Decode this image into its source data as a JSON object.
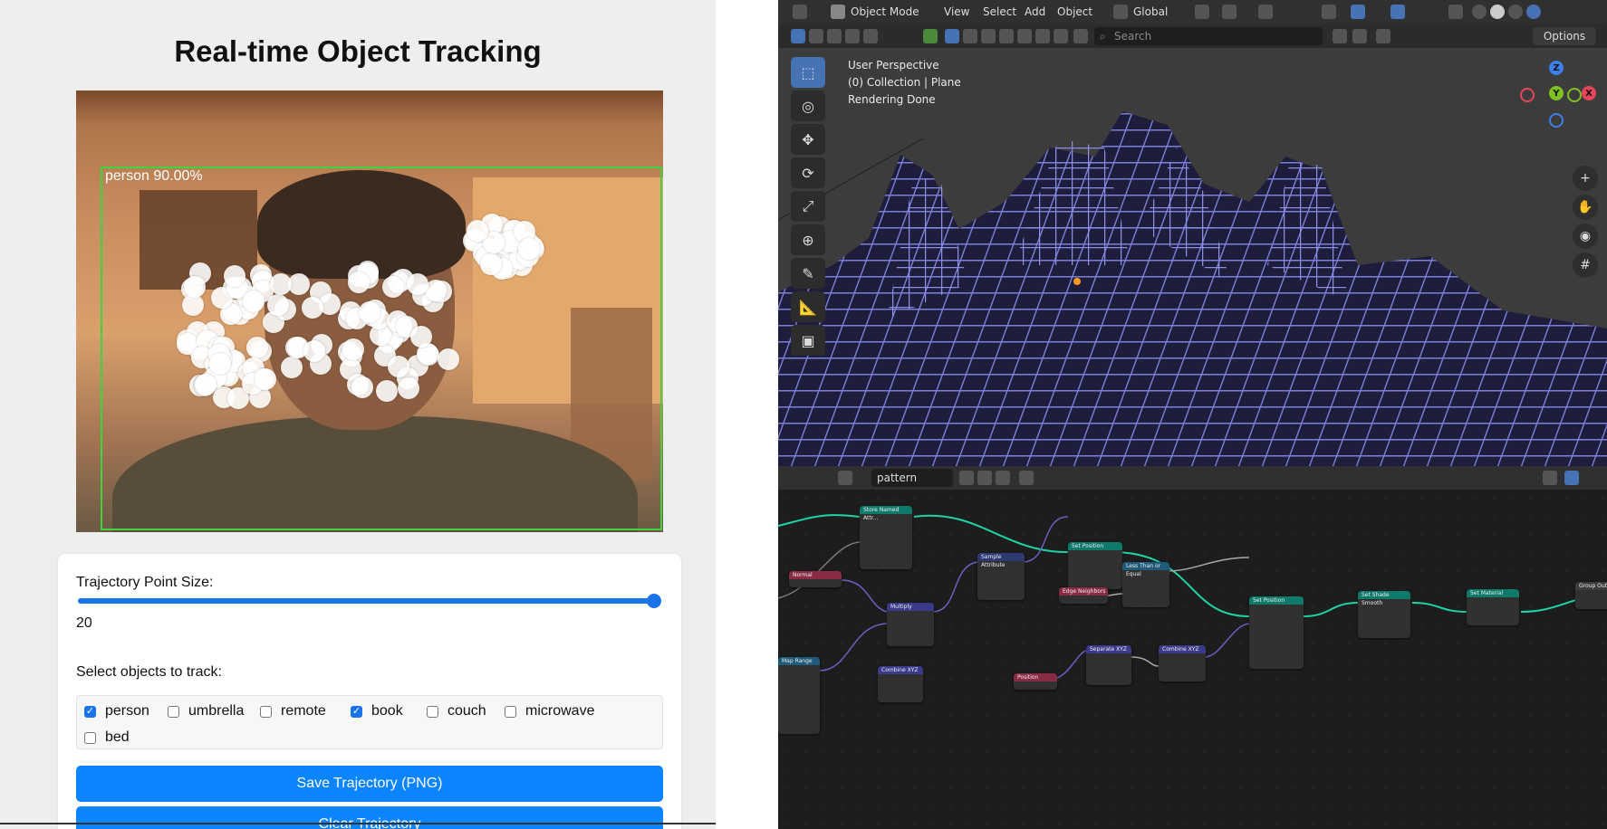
{
  "app": {
    "title": "Real-time Object Tracking",
    "detection_label": "person 90.00%",
    "trajectory_label": "Trajectory Point Size:",
    "point_size": "20",
    "point_size_range": {
      "min": 0,
      "max": 20,
      "value": 20
    },
    "select_label": "Select objects to track:",
    "objects": [
      {
        "label": "person",
        "checked": true
      },
      {
        "label": "umbrella",
        "checked": false
      },
      {
        "label": "remote",
        "checked": false
      },
      {
        "label": "book",
        "checked": true
      },
      {
        "label": "couch",
        "checked": false
      },
      {
        "label": "microwave",
        "checked": false
      },
      {
        "label": "bed",
        "checked": false
      }
    ],
    "save_button": "Save Trajectory (PNG)",
    "clear_button": "Clear Trajectory",
    "accent_color": "#0a84ff"
  },
  "blender": {
    "mode": "Object Mode",
    "menu": [
      "View",
      "Select",
      "Add",
      "Object"
    ],
    "transform_orientation": "Global",
    "search_placeholder": "Search",
    "options_label": "Options",
    "viewport_info": [
      "User Perspective",
      "(0) Collection | Plane",
      "Rendering Done"
    ],
    "gizmo_axes": [
      "Z",
      "Y",
      "X"
    ],
    "node_group_name": "pattern",
    "nodes": [
      {
        "title": "Store Named Attr..."
      },
      {
        "title": "Set Position"
      },
      {
        "title": "Set Position"
      },
      {
        "title": "Set Shade Smooth"
      },
      {
        "title": "Set Material"
      },
      {
        "title": "Group Output"
      },
      {
        "title": "Normal"
      },
      {
        "title": "Multiply"
      },
      {
        "title": "Sample Attribute"
      },
      {
        "title": "Less Than or Equal"
      },
      {
        "title": "Edge Neighbors"
      },
      {
        "title": "Separate XYZ"
      },
      {
        "title": "Combine XYZ"
      },
      {
        "title": "Combine XYZ"
      },
      {
        "title": "Map Range"
      },
      {
        "title": "Position"
      }
    ]
  }
}
